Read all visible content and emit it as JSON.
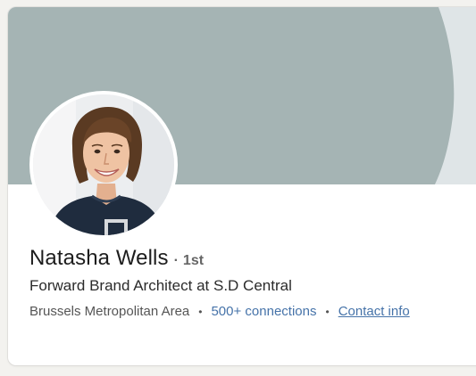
{
  "profile": {
    "name": "Natasha Wells",
    "degree": "1st",
    "degree_separator": "·",
    "headline": "Forward Brand Architect at S.D Central",
    "location": "Brussels Metropolitan Area",
    "meta_separator": "•",
    "connections": "500+ connections",
    "contact_info": "Contact info"
  },
  "colors": {
    "page_background": "#f3f2ef",
    "banner_primary": "#a5b4b4",
    "banner_secondary": "#dfe5e7",
    "link": "#4673a9",
    "name_text": "#1d1d1d",
    "muted_text": "#666666"
  },
  "icons": {
    "avatar": "profile-photo"
  }
}
